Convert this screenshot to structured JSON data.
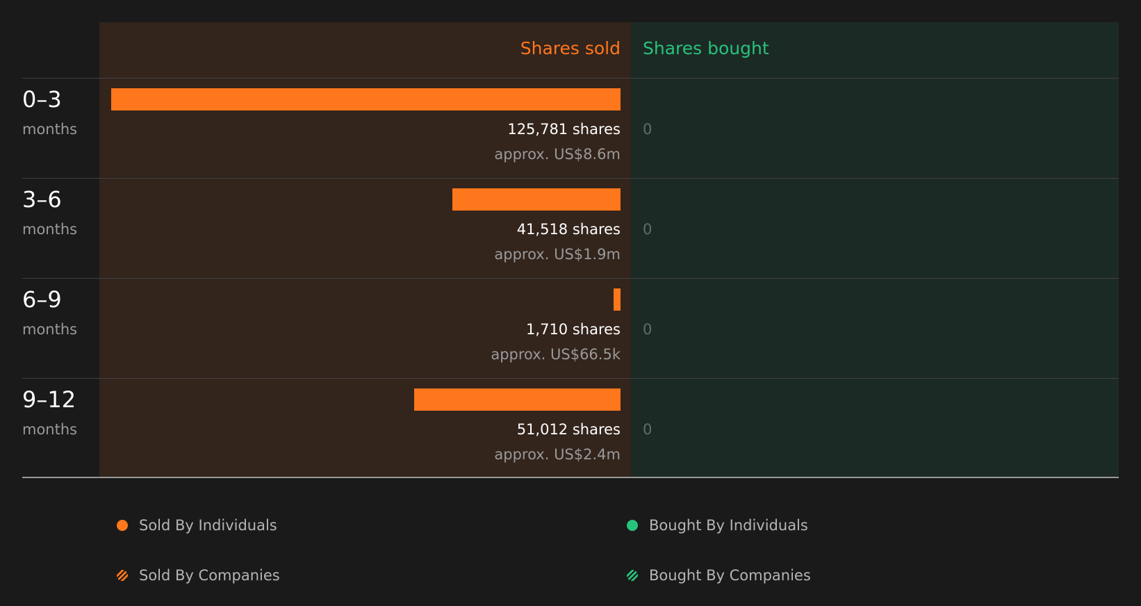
{
  "header": {
    "sold_label": "Shares sold",
    "bought_label": "Shares bought"
  },
  "colors": {
    "sold": "#ff771c",
    "bought": "#27c27b",
    "sold_panel": "#33241c",
    "bought_panel": "#1c2a25",
    "background": "#1a1a1a"
  },
  "chart_data": {
    "type": "bar",
    "orientation": "horizontal",
    "categories": [
      "0–3 months",
      "3–6 months",
      "6–9 months",
      "9–12 months"
    ],
    "series": [
      {
        "name": "Shares sold",
        "values": [
          125781,
          41518,
          1710,
          51012
        ]
      },
      {
        "name": "Shares bought",
        "values": [
          0,
          0,
          0,
          0
        ]
      }
    ]
  },
  "rows": [
    {
      "range": "0–3",
      "unit": "months",
      "sold_shares": 125781,
      "sold_text": "125,781 shares",
      "sold_value": "approx. US$8.6m",
      "bought_text": "0"
    },
    {
      "range": "3–6",
      "unit": "months",
      "sold_shares": 41518,
      "sold_text": "41,518 shares",
      "sold_value": "approx. US$1.9m",
      "bought_text": "0"
    },
    {
      "range": "6–9",
      "unit": "months",
      "sold_shares": 1710,
      "sold_text": "1,710 shares",
      "sold_value": "approx. US$66.5k",
      "bought_text": "0"
    },
    {
      "range": "9–12",
      "unit": "months",
      "sold_shares": 51012,
      "sold_text": "51,012 shares",
      "sold_value": "approx. US$2.4m",
      "bought_text": "0"
    }
  ],
  "legend": [
    {
      "label": "Sold By Individuals",
      "style": "solid",
      "color": "#ff771c"
    },
    {
      "label": "Bought By Individuals",
      "style": "solid",
      "color": "#27c27b"
    },
    {
      "label": "Sold By Companies",
      "style": "hatched",
      "color": "#ff771c"
    },
    {
      "label": "Bought By Companies",
      "style": "hatched",
      "color": "#27c27b"
    }
  ]
}
